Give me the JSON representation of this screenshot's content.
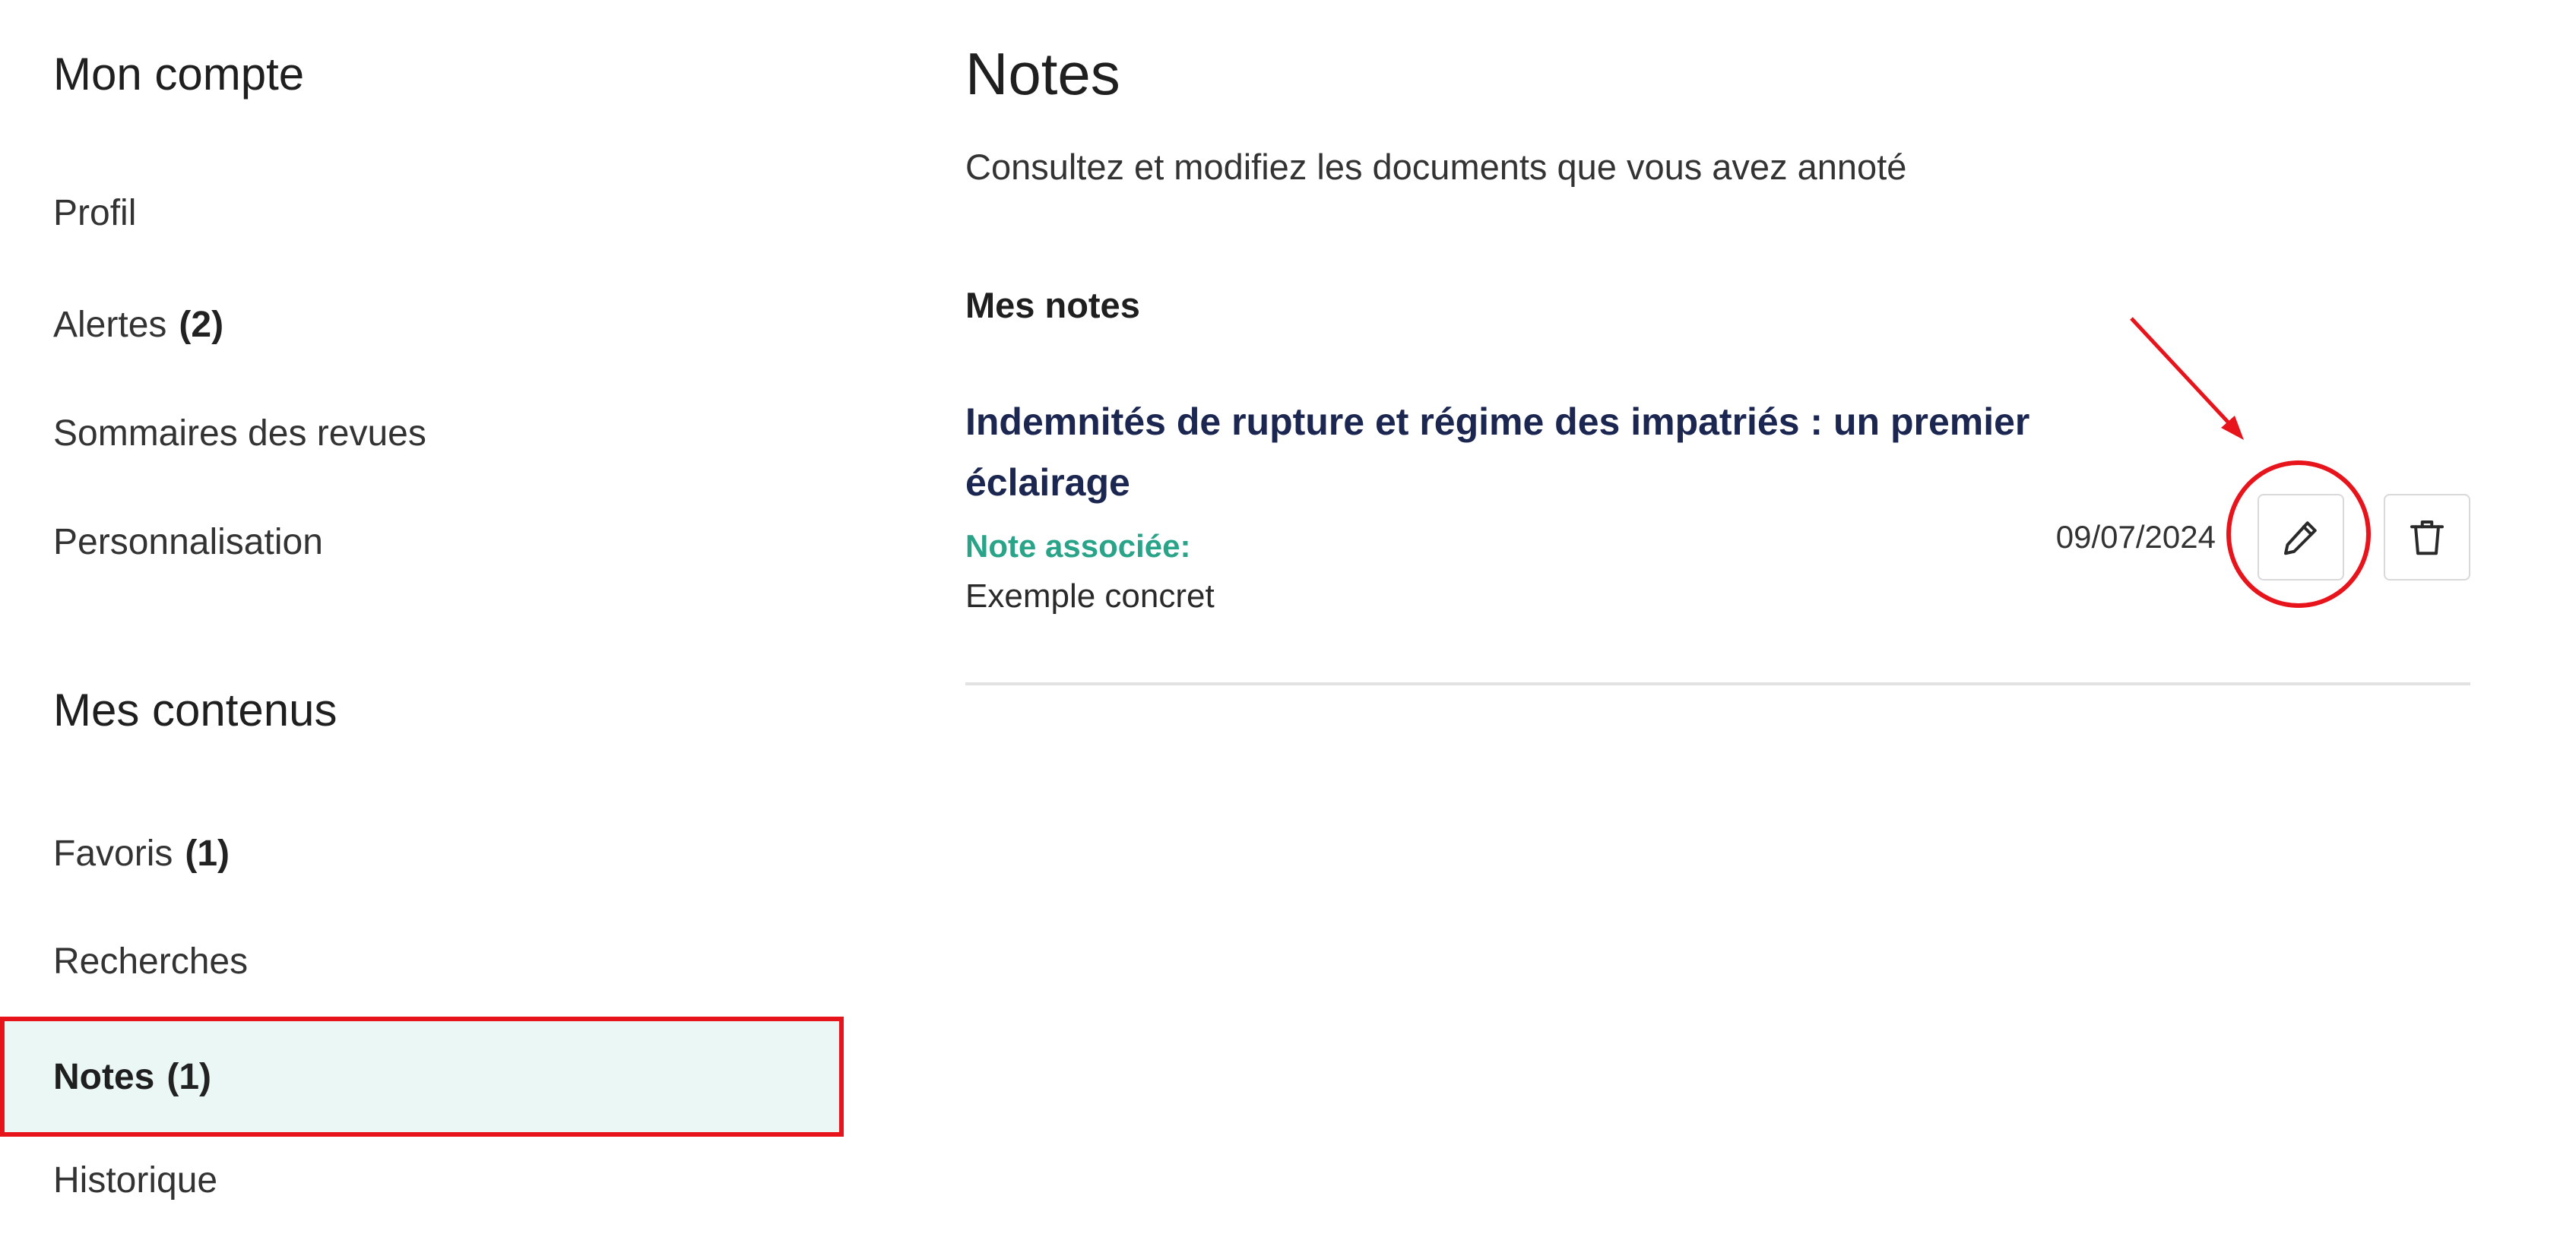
{
  "sidebar": {
    "account_title": "Mon compte",
    "account_items": [
      {
        "label": "Profil",
        "count": ""
      },
      {
        "label": "Alertes",
        "count": "(2)"
      },
      {
        "label": "Sommaires des revues",
        "count": ""
      },
      {
        "label": "Personnalisation",
        "count": ""
      }
    ],
    "content_title": "Mes contenus",
    "content_items": [
      {
        "label": "Favoris",
        "count": "(1)"
      },
      {
        "label": "Recherches",
        "count": ""
      },
      {
        "label": "Notes",
        "count": "(1)",
        "active": true
      },
      {
        "label": "Historique",
        "count": ""
      }
    ]
  },
  "main": {
    "title": "Notes",
    "subtitle": "Consultez et modifiez les documents que vous avez annoté",
    "section_label": "Mes notes",
    "notes": [
      {
        "title": "Indemnités de rupture et régime des impatriés : un premier éclairage",
        "note_label": "Note associée:",
        "note_text": "Exemple concret",
        "date": "09/07/2024",
        "edit_icon": "pencil-icon",
        "delete_icon": "trash-icon"
      }
    ]
  },
  "colors": {
    "accent_green": "#2aa488",
    "active_bg": "#eaf7f4",
    "title_navy": "#1b2750",
    "annotation_red": "#e8141c"
  }
}
